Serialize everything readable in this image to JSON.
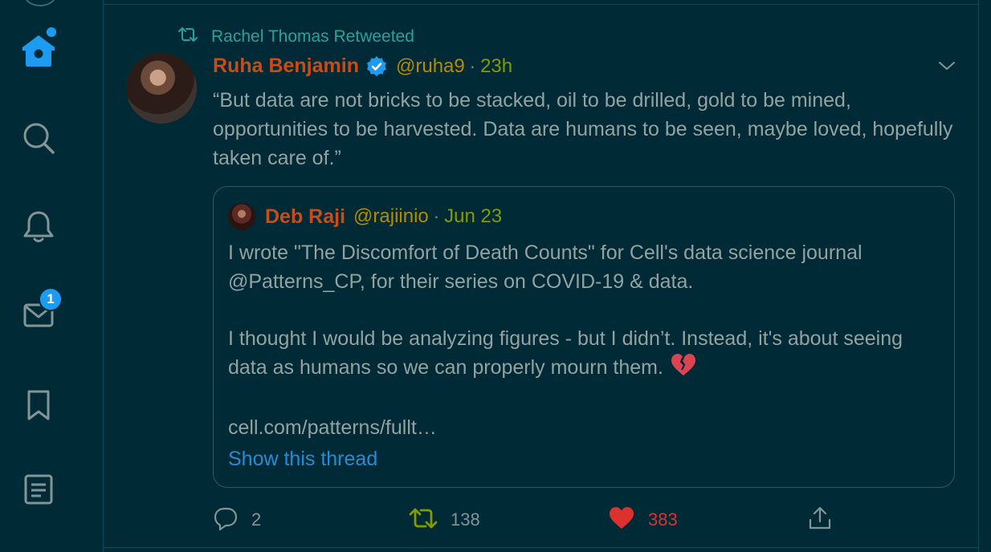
{
  "sidebar": {
    "items": [
      {
        "name": "home",
        "icon": "home-icon"
      },
      {
        "name": "explore",
        "icon": "search-icon"
      },
      {
        "name": "notifications",
        "icon": "bell-icon"
      },
      {
        "name": "messages",
        "icon": "mail-icon",
        "badge": "1"
      },
      {
        "name": "bookmarks",
        "icon": "bookmark-icon"
      },
      {
        "name": "lists",
        "icon": "list-icon"
      }
    ],
    "active_color": "#1d9bf0"
  },
  "tweet": {
    "retweet_label": "Rachel Thomas Retweeted",
    "author": {
      "name": "Ruha Benjamin",
      "handle": "@ruha9",
      "verified": true
    },
    "separator": "·",
    "time": "23h",
    "text": "“But data are not bricks to be stacked, oil to be drilled, gold to be mined, opportunities to be harvested. Data are humans to be seen, maybe loved, hopefully taken care of.”",
    "quote": {
      "author": {
        "name": "Deb Raji",
        "handle": "@rajiinio"
      },
      "time": "Jun 23",
      "paragraph1": "I wrote \"The Discomfort of Death Counts\" for Cell's data science journal @Patterns_CP, for their series on COVID-19 & data.",
      "paragraph2": "I thought I would be analyzing figures - but I didn’t. Instead, it's about seeing data as humans so we can properly mourn them.",
      "emoji": "broken-heart-icon",
      "link": "cell.com/patterns/fullt…",
      "show_thread": "Show this thread"
    },
    "actions": {
      "replies": "2",
      "retweets": "138",
      "likes": "383",
      "retweet_color": "#859900",
      "like_color": "#dc322f"
    }
  },
  "theme": {
    "background": "#002b36",
    "text": "#93a1a1",
    "name": "#cb4b16",
    "handle": "#b58900",
    "time": "#859900",
    "link": "#268bd2",
    "retweet_label": "#2aa198"
  }
}
